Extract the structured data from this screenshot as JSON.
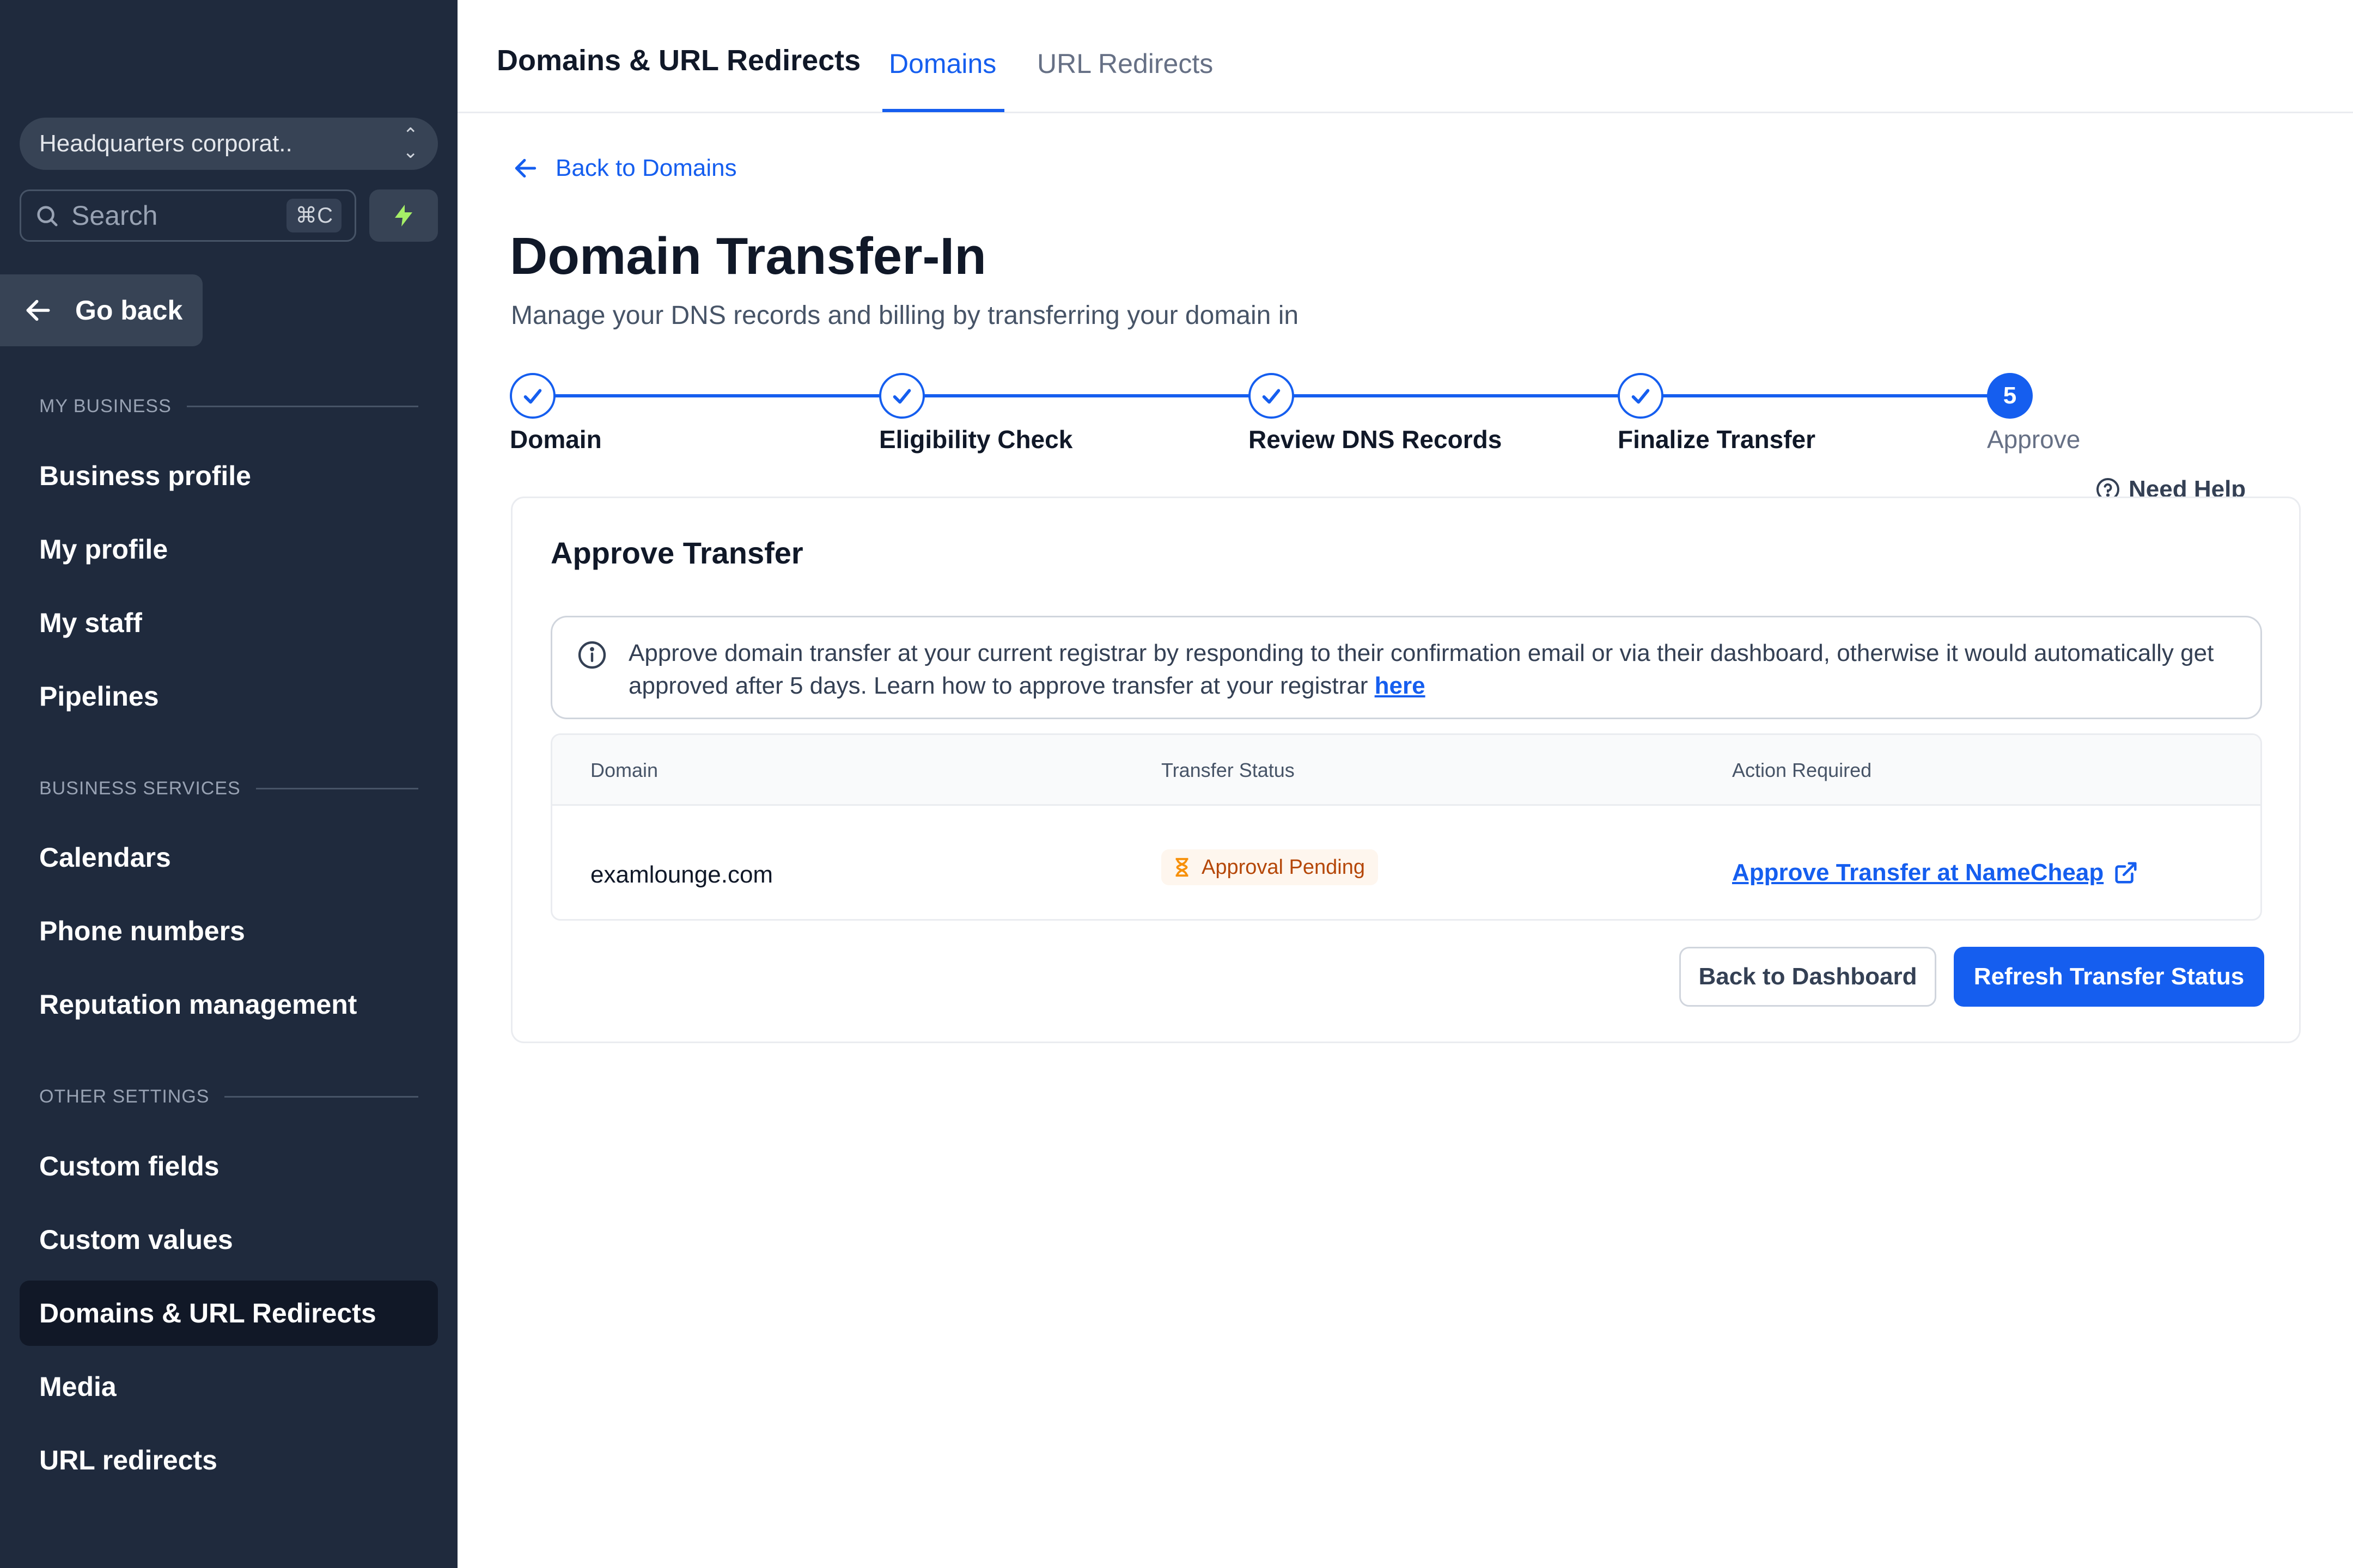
{
  "sidebar": {
    "location_label": "Headquarters corporat..",
    "search": {
      "placeholder": "Search",
      "shortcut": "⌘C"
    },
    "go_back": "Go back",
    "sections": [
      {
        "title": "MY BUSINESS",
        "items": [
          "Business profile",
          "My profile",
          "My staff",
          "Pipelines"
        ]
      },
      {
        "title": "BUSINESS SERVICES",
        "items": [
          "Calendars",
          "Phone numbers",
          "Reputation management"
        ]
      },
      {
        "title": "OTHER SETTINGS",
        "items": [
          "Custom fields",
          "Custom values",
          "Domains & URL Redirects",
          "Media",
          "URL redirects"
        ]
      }
    ],
    "active_item": "Domains & URL Redirects"
  },
  "header": {
    "title": "Domains & URL Redirects",
    "tabs": [
      {
        "label": "Domains",
        "active": true
      },
      {
        "label": "URL Redirects",
        "active": false
      }
    ]
  },
  "main": {
    "back_link": "Back to Domains",
    "title": "Domain Transfer-In",
    "subtitle": "Manage your DNS records and billing by transferring your domain in",
    "steps": [
      {
        "label": "Domain",
        "status": "done"
      },
      {
        "label": "Eligibility Check",
        "status": "done"
      },
      {
        "label": "Review DNS Records",
        "status": "done"
      },
      {
        "label": "Finalize Transfer",
        "status": "done"
      },
      {
        "label": "Approve",
        "status": "current",
        "number": "5"
      }
    ],
    "need_help": "Need Help",
    "card": {
      "title": "Approve Transfer",
      "info_text": "Approve domain transfer at your current registrar by responding to their confirmation email or via their dashboard, otherwise it would automatically get approved after 5 days. Learn how to approve transfer at your registrar",
      "info_link": "here",
      "table": {
        "headers": [
          "Domain",
          "Transfer Status",
          "Action Required"
        ],
        "rows": [
          {
            "domain": "examlounge.com",
            "status": "Approval Pending",
            "action": "Approve Transfer at NameCheap"
          }
        ]
      },
      "buttons": {
        "secondary": "Back to Dashboard",
        "primary": "Refresh Transfer Status"
      }
    }
  },
  "colors": {
    "sidebar_bg": "#1f2a3d",
    "accent": "#155eef",
    "pending_badge_bg": "#fef6ee",
    "pending_badge_text": "#b54708",
    "bolt": "#a6ef67"
  },
  "icons": {
    "back": "arrow-left-icon",
    "search": "search-icon",
    "bolt": "bolt-icon",
    "step_done": "check-icon",
    "info": "info-icon",
    "help": "help-circle-icon",
    "pending": "hourglass-icon",
    "external": "external-link-icon"
  }
}
